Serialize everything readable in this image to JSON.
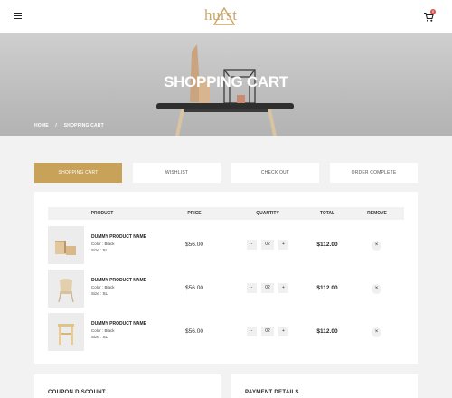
{
  "header": {
    "logo_text": "hurst",
    "cart_count": "0",
    "brand_color": "#c9a86a"
  },
  "hero": {
    "title": "SHOPPING CART",
    "breadcrumb": [
      "HOME",
      "/",
      "SHOPPING CART"
    ]
  },
  "steps": [
    {
      "label": "SHOPPING CART",
      "active": true
    },
    {
      "label": "WISHLIST",
      "active": false
    },
    {
      "label": "CHECK OUT",
      "active": false
    },
    {
      "label": "ORDER COMPLETE",
      "active": false
    }
  ],
  "cart": {
    "columns": [
      "PRODUCT",
      "PRICE",
      "QUANTITY",
      "TOTAL",
      "REMOVE"
    ],
    "items": [
      {
        "name": "DUMMY PRODUCT NAME",
        "color": "Color : Black",
        "size": "Size : SL",
        "price": "$56.00",
        "qty": "02",
        "total": "$112.00",
        "minus": "-",
        "plus": "+",
        "remove": "×"
      },
      {
        "name": "DUMMY PRODUCT NAME",
        "color": "Color : Black",
        "size": "Size : SL",
        "price": "$56.00",
        "qty": "02",
        "total": "$112.00",
        "minus": "-",
        "plus": "+",
        "remove": "×"
      },
      {
        "name": "DUMMY PRODUCT NAME",
        "color": "Color : Black",
        "size": "Size : SL",
        "price": "$56.00",
        "qty": "02",
        "total": "$112.00",
        "minus": "-",
        "plus": "+",
        "remove": "×"
      }
    ]
  },
  "coupon": {
    "title": "COUPON DISCOUNT"
  },
  "payment": {
    "title": "PAYMENT DETAILS"
  }
}
